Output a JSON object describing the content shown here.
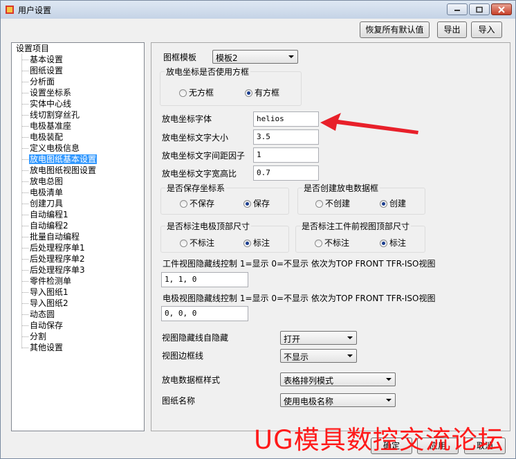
{
  "window": {
    "title": "用户设置"
  },
  "toolbar": {
    "restore_defaults": "恢复所有默认值",
    "export": "导出",
    "import": "导入"
  },
  "tree": {
    "root": "设置项目",
    "items": [
      "基本设置",
      "图纸设置",
      "分析面",
      "设置坐标系",
      "实体中心线",
      "线切割穿丝孔",
      "电极基准座",
      "电极装配",
      "定义电极信息",
      "放电图纸基本设置",
      "放电图纸视图设置",
      "放电总图",
      "电极清单",
      "创建刀具",
      "自动编程1",
      "自动编程2",
      "批量自动编程",
      "后处理程序单1",
      "后处理程序单2",
      "后处理程序单3",
      "零件检测单",
      "导入图纸1",
      "导入图纸2",
      "动态圆",
      "自动保存",
      "分割",
      "其他设置"
    ],
    "selected_index": 9
  },
  "form": {
    "frame_template": {
      "label": "图框模板",
      "value": "模板2"
    },
    "coord_square": {
      "title": "放电坐标是否使用方框",
      "opt_no": "无方框",
      "opt_yes": "有方框",
      "selected": "yes"
    },
    "coord_font": {
      "label": "放电坐标字体",
      "value": "helios"
    },
    "coord_text_size": {
      "label": "放电坐标文字大小",
      "value": "3.5"
    },
    "coord_spacing": {
      "label": "放电坐标文字间距因子",
      "value": "1"
    },
    "coord_aspect": {
      "label": "放电坐标文字宽高比",
      "value": "0.7"
    },
    "keep_csys": {
      "title": "是否保存坐标系",
      "opt_no": "不保存",
      "opt_yes": "保存",
      "selected": "yes"
    },
    "create_frame": {
      "title": "是否创建放电数据框",
      "opt_no": "不创建",
      "opt_yes": "创建",
      "selected": "yes"
    },
    "electrode_top": {
      "title": "是否标注电极顶部尺寸",
      "opt_no": "不标注",
      "opt_yes": "标注",
      "selected": "yes"
    },
    "workpiece_top": {
      "title": "是否标注工件前视图顶部尺寸",
      "opt_no": "不标注",
      "opt_yes": "标注",
      "selected": "yes"
    },
    "workpiece_hidden": {
      "label": "工件视图隐藏线控制 1=显示 0=不显示 依次为TOP FRONT TFR-ISO视图",
      "value": "1, 1, 0"
    },
    "electrode_hidden": {
      "label": "电极视图隐藏线控制 1=显示 0=不显示 依次为TOP FRONT TFR-ISO视图",
      "value": "0, 0, 0"
    },
    "auto_hide": {
      "label": "视图隐藏线自隐藏",
      "value": "打开"
    },
    "view_border": {
      "label": "视图边框线",
      "value": "不显示"
    },
    "frame_style": {
      "label": "放电数据框样式",
      "value": "表格排列模式"
    },
    "sheet_name": {
      "label": "图纸名称",
      "value": "使用电极名称"
    }
  },
  "footer": {
    "ok": "确定",
    "apply": "应用",
    "cancel": "取消"
  },
  "watermark": "UG模具数控交流论坛",
  "colors": {
    "selection": "#3399ff",
    "arrow": "#e8202a",
    "watermark": "#ff1a1a"
  }
}
